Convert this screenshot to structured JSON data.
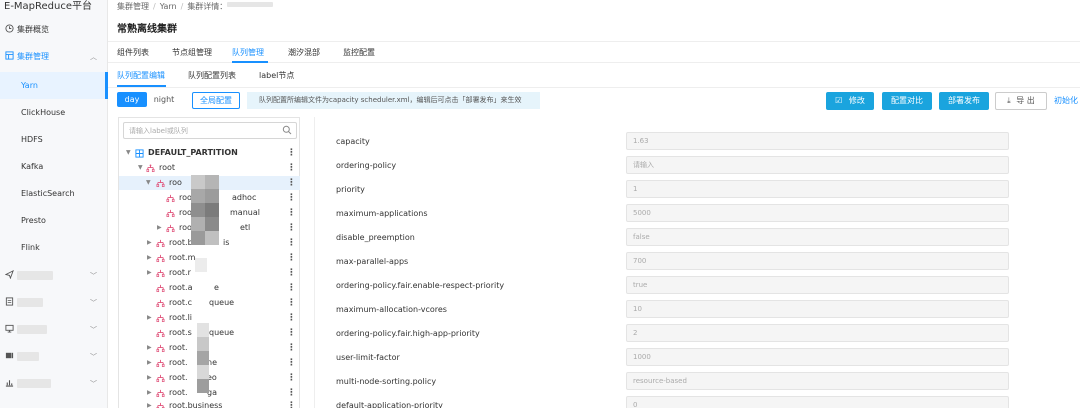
{
  "sidebar": {
    "brand": "E-MapReduce平台",
    "items": [
      {
        "label": "集群概览",
        "icon": "clock-icon"
      },
      {
        "label": "集群管理",
        "icon": "cluster-icon"
      }
    ],
    "sub_items": [
      "Yarn",
      "ClickHouse",
      "HDFS",
      "Kafka",
      "ElasticSearch",
      "Presto",
      "Flink"
    ]
  },
  "breadcrumb": [
    "集群管理",
    "Yarn",
    "集群详情："
  ],
  "page_title": "常熟离线集群",
  "tabs": [
    "组件列表",
    "节点组管理",
    "队列管理",
    "潮汐混部",
    "监控配置"
  ],
  "subtabs": [
    "队列配置编辑",
    "队列配置列表",
    "label节点"
  ],
  "toolbar": {
    "day": "day",
    "night": "night",
    "global_config": "全局配置",
    "notice": "队列配置所编辑文件为capacity scheduler.xml，编辑后可点击「部署发布」来生效",
    "edit": "修改",
    "compare": "配置对比",
    "deploy": "部署发布",
    "export": "导 出",
    "init": "初始化"
  },
  "tree": {
    "search_placeholder": "请输入label或队列",
    "nodes": [
      "DEFAULT_PARTITION",
      "root",
      "roo",
      "roo",
      "roo",
      "roo",
      "root.b",
      "root.m",
      "root.r",
      "root.a",
      "root.c",
      "root.li",
      "root.s",
      "root.",
      "root.",
      "root.",
      "root.",
      "root.business"
    ],
    "suffixes": [
      "adhoc",
      "manual",
      "etl",
      "is",
      "e",
      "queue",
      "queue",
      "ne",
      "eo",
      "ga"
    ]
  },
  "form": {
    "fields": [
      {
        "label": "capacity",
        "value": "1.63"
      },
      {
        "label": "ordering-policy",
        "value": "请输入"
      },
      {
        "label": "priority",
        "value": "1"
      },
      {
        "label": "maximum-applications",
        "value": "5000"
      },
      {
        "label": "disable_preemption",
        "value": "false"
      },
      {
        "label": "max-parallel-apps",
        "value": "700"
      },
      {
        "label": "ordering-policy.fair.enable-respect-priority",
        "value": "true"
      },
      {
        "label": "maximum-allocation-vcores",
        "value": "10"
      },
      {
        "label": "ordering-policy.fair.high-app-priority",
        "value": "2"
      },
      {
        "label": "user-limit-factor",
        "value": "1000"
      },
      {
        "label": "multi-node-sorting.policy",
        "value": "resource-based"
      },
      {
        "label": "default-application-priority",
        "value": "0"
      }
    ]
  },
  "colors": {
    "accent": "#1890ff",
    "primary_button": "#1aa4de",
    "queue_icon": "#e0527a",
    "selected_row": "#e6f1fc"
  }
}
